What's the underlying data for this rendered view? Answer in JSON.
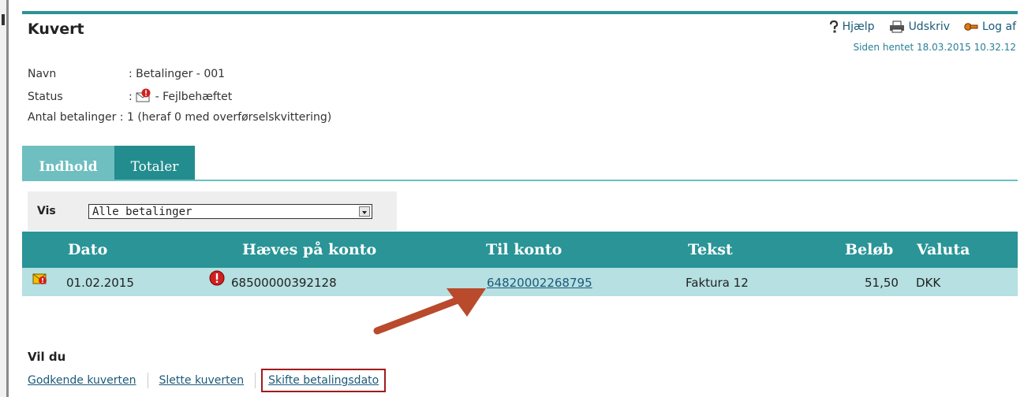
{
  "window": {
    "title": "Kuvert"
  },
  "header": {
    "help": "Hjælp",
    "print": "Udskriv",
    "logout": "Log af",
    "fetched": "Siden hentet 18.03.2015 10.32.12"
  },
  "info": {
    "name_label": "Navn",
    "name_value": ": Betalinger - 001",
    "status_label": "Status",
    "status_prefix": ":",
    "status_value": "- Fejlbehæftet",
    "count_label": "Antal betalinger",
    "count_value": ": 1 (heraf 0 med overførselskvittering)"
  },
  "tabs": [
    {
      "label": "Indhold",
      "active": true
    },
    {
      "label": "Totaler",
      "active": false
    }
  ],
  "filter": {
    "label": "Vis",
    "selected": "Alle betalinger"
  },
  "table": {
    "headers": [
      "Dato",
      "Hæves på konto",
      "Til konto",
      "Tekst",
      "Beløb",
      "Valuta"
    ],
    "rows": [
      {
        "date": "01.02.2015",
        "from_account": "68500000392128",
        "to_account": "64820002268795",
        "text": "Faktura 12",
        "amount": "51,50",
        "currency": "DKK"
      }
    ]
  },
  "actions": {
    "heading": "Vil du",
    "items": [
      "Godkende kuverten",
      "Slette kuverten",
      "Skifte betalingsdato"
    ]
  },
  "colors": {
    "accent": "#2a9497",
    "tab_active": "#6fbfc0",
    "row_bg": "#b6e0e1",
    "highlight": "#a01c1c",
    "arrow": "#b94a2c"
  },
  "icons": [
    "help-icon",
    "printer-icon",
    "logout-key-icon",
    "error-envelope-icon",
    "error-icon",
    "error-envelope-icon-row"
  ]
}
